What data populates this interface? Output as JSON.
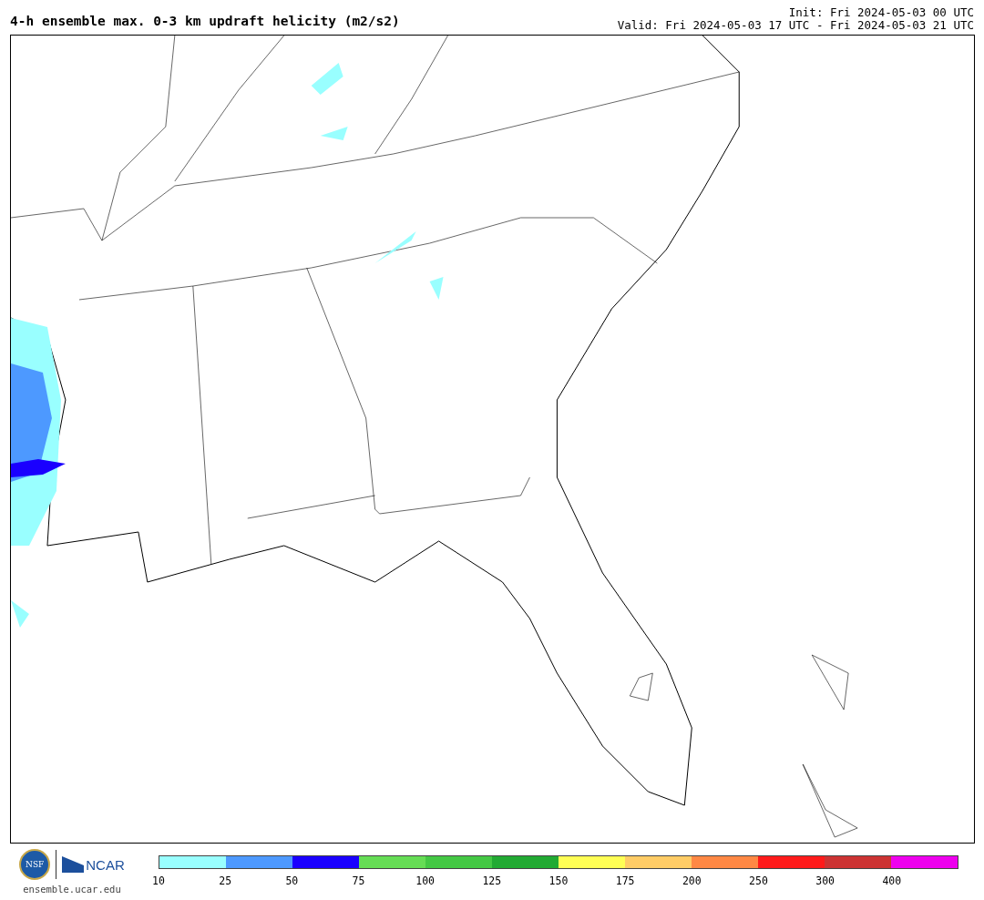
{
  "title": "4-h ensemble max. 0-3 km updraft helicity (m2/s2)",
  "init": "Init: Fri 2024-05-03 00 UTC",
  "valid": "Valid: Fri 2024-05-03 17 UTC - Fri 2024-05-03 21 UTC",
  "logos": {
    "nsf": "NSF",
    "ncar": "NCAR",
    "site": "ensemble.ucar.edu"
  },
  "colorbar": [
    {
      "color": "#99ffff",
      "label": "10"
    },
    {
      "color": "#4d99ff",
      "label": "25"
    },
    {
      "color": "#1a00ff",
      "label": "50"
    },
    {
      "color": "#66dd55",
      "label": "75"
    },
    {
      "color": "#44c844",
      "label": "100"
    },
    {
      "color": "#22aa33",
      "label": "125"
    },
    {
      "color": "#ffff55",
      "label": "150"
    },
    {
      "color": "#ffcc66",
      "label": "175"
    },
    {
      "color": "#ff8844",
      "label": "200"
    },
    {
      "color": "#ff1a1a",
      "label": "250"
    },
    {
      "color": "#cc3333",
      "label": "300"
    },
    {
      "color": "#ee00ee",
      "label": "400"
    }
  ]
}
